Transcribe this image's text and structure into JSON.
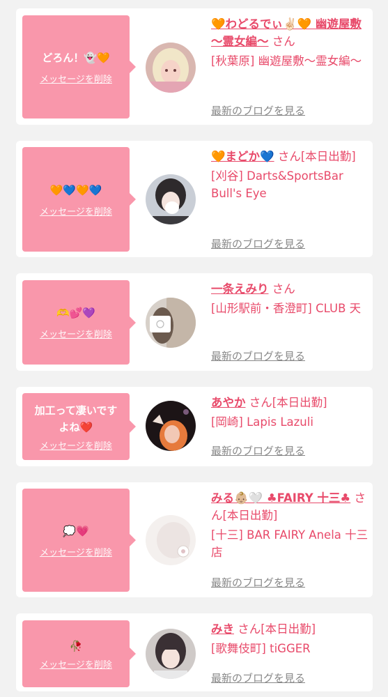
{
  "delete_label": "メッセージを削除",
  "blog_label": "最新のブログを見る",
  "cards": [
    {
      "message": "どろん！👻🧡",
      "name": "🧡わどるでぃ✌🏻🧡 幽遊屋敷 〜霊女編〜",
      "suffix": "さん",
      "shop": "[秋葉原] 幽遊屋敷〜霊女編〜"
    },
    {
      "message": "🧡💙🧡💙",
      "name": "🧡まどか💙",
      "suffix": "さん[本日出勤]",
      "shop": "[刈谷] Darts&SportsBar Bull's Eye"
    },
    {
      "message": "🫶💕💜",
      "name": "一条えみり",
      "suffix": "さん",
      "shop": "[山形駅前・香澄町] CLUB 天"
    },
    {
      "message": "加工って凄いですよね❤️",
      "name": "あやか",
      "suffix": "さん[本日出勤]",
      "shop": "[岡崎] Lapis Lazuli"
    },
    {
      "message": "💭💗",
      "name": "みる👶🏼🤍 ♣FAIRY 十三♣",
      "suffix": "さん[本日出勤]",
      "shop": "[十三] BAR FAIRY Anela 十三店"
    },
    {
      "message": "🥀",
      "name": "みき",
      "suffix": "さん[本日出勤]",
      "shop": "[歌舞伎町] tiGGER"
    }
  ],
  "colors": {
    "bubble": "#f997ab",
    "accent": "#e84a6a",
    "background": "#f2f2f2"
  }
}
